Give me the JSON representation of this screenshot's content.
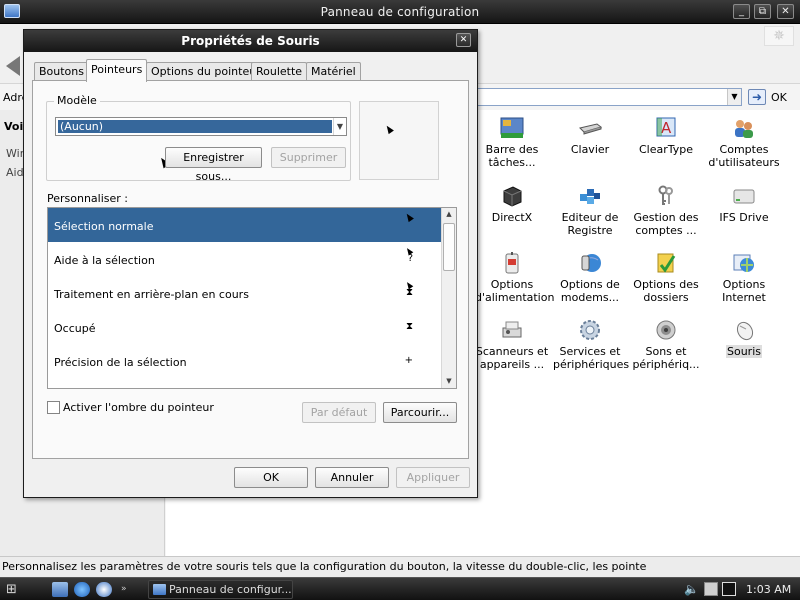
{
  "window": {
    "title": "Panneau de configuration",
    "minimize_glyph": "_",
    "maximize_glyph": "⧉",
    "close_glyph": "✕"
  },
  "toolbar": {
    "back_icon": "back-arrow-icon",
    "throbber_glyph": "✵"
  },
  "addressbar": {
    "label": "Adre",
    "dropdown_glyph": "▼",
    "go_glyph": "➜",
    "go_label": "OK"
  },
  "left_pane": {
    "title": "Voi",
    "line1": "Win",
    "line2": "Aide"
  },
  "icons": [
    {
      "label": "Barre des tâches...",
      "icon": "taskbar-icon",
      "selected": false
    },
    {
      "label": "Clavier",
      "icon": "keyboard-icon",
      "selected": false
    },
    {
      "label": "ClearType",
      "icon": "cleartype-icon",
      "selected": false
    },
    {
      "label": "Comptes d'utilisateurs",
      "icon": "user-accounts-icon",
      "selected": false
    },
    {
      "label": "DirectX",
      "icon": "directx-icon",
      "selected": false
    },
    {
      "label": "Editeur de Registre",
      "icon": "registry-editor-icon",
      "selected": false
    },
    {
      "label": "Gestion des comptes ...",
      "icon": "keys-icon",
      "selected": false
    },
    {
      "label": "IFS Drive",
      "icon": "drive-icon",
      "selected": false
    },
    {
      "label": "Options d'alimentation",
      "icon": "power-options-icon",
      "selected": false
    },
    {
      "label": "Options de modems...",
      "icon": "phone-modem-icon",
      "selected": false
    },
    {
      "label": "Options des dossiers",
      "icon": "folder-options-icon",
      "selected": false
    },
    {
      "label": "Options Internet",
      "icon": "internet-options-icon",
      "selected": false
    },
    {
      "label": "Scanneurs et appareils ...",
      "icon": "scanner-icon",
      "selected": false
    },
    {
      "label": "Services et périphériques",
      "icon": "services-gear-icon",
      "selected": false
    },
    {
      "label": "Sons et périphériq...",
      "icon": "speaker-icon",
      "selected": false
    },
    {
      "label": "Souris",
      "icon": "mouse-icon",
      "selected": true
    }
  ],
  "statusbar": {
    "text": "Personnalisez les paramètres de votre souris tels que la configuration du bouton, la vitesse du double-clic, les pointe"
  },
  "taskbar": {
    "task_label": "Panneau de configur...",
    "clock": "1:03 AM",
    "start_glyph": "⊞"
  },
  "dialog": {
    "title": "Propriétés de Souris",
    "close_glyph": "✕",
    "tabs": [
      {
        "label": "Boutons",
        "active": false
      },
      {
        "label": "Pointeurs",
        "active": true
      },
      {
        "label": "Options du pointeur",
        "active": false
      },
      {
        "label": "Roulette",
        "active": false
      },
      {
        "label": "Matériel",
        "active": false
      }
    ],
    "scheme_group_label": "Modèle",
    "scheme_value": "(Aucun)",
    "scheme_dropdown_glyph": "▼",
    "save_as_label": "Enregistrer sous...",
    "delete_label": "Supprimer",
    "customize_label": "Personnaliser :",
    "cursor_rows": [
      {
        "label": "Sélection normale",
        "cursor_glyph": "",
        "selected": true
      },
      {
        "label": "Aide à la sélection",
        "cursor_glyph": "?",
        "selected": false
      },
      {
        "label": "Traitement en arrière-plan en cours",
        "cursor_glyph": "⧗",
        "selected": false
      },
      {
        "label": "Occupé",
        "cursor_glyph": "⧗",
        "selected": false
      },
      {
        "label": "Précision de la sélection",
        "cursor_glyph": "+",
        "selected": false
      }
    ],
    "scroll_up_glyph": "▲",
    "scroll_down_glyph": "▼",
    "shadow_checkbox_label": "Activer l'ombre du pointeur",
    "shadow_checked": false,
    "default_label": "Par défaut",
    "browse_label": "Parcourir...",
    "ok_label": "OK",
    "cancel_label": "Annuler",
    "apply_label": "Appliquer"
  }
}
